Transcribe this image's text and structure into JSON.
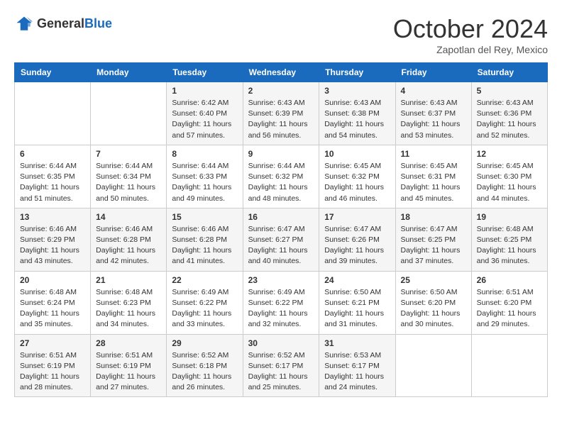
{
  "header": {
    "logo_general": "General",
    "logo_blue": "Blue",
    "month_title": "October 2024",
    "location": "Zapotlan del Rey, Mexico"
  },
  "days_of_week": [
    "Sunday",
    "Monday",
    "Tuesday",
    "Wednesday",
    "Thursday",
    "Friday",
    "Saturday"
  ],
  "weeks": [
    [
      {
        "day": "",
        "info": ""
      },
      {
        "day": "",
        "info": ""
      },
      {
        "day": "1",
        "info": "Sunrise: 6:42 AM\nSunset: 6:40 PM\nDaylight: 11 hours and 57 minutes."
      },
      {
        "day": "2",
        "info": "Sunrise: 6:43 AM\nSunset: 6:39 PM\nDaylight: 11 hours and 56 minutes."
      },
      {
        "day": "3",
        "info": "Sunrise: 6:43 AM\nSunset: 6:38 PM\nDaylight: 11 hours and 54 minutes."
      },
      {
        "day": "4",
        "info": "Sunrise: 6:43 AM\nSunset: 6:37 PM\nDaylight: 11 hours and 53 minutes."
      },
      {
        "day": "5",
        "info": "Sunrise: 6:43 AM\nSunset: 6:36 PM\nDaylight: 11 hours and 52 minutes."
      }
    ],
    [
      {
        "day": "6",
        "info": "Sunrise: 6:44 AM\nSunset: 6:35 PM\nDaylight: 11 hours and 51 minutes."
      },
      {
        "day": "7",
        "info": "Sunrise: 6:44 AM\nSunset: 6:34 PM\nDaylight: 11 hours and 50 minutes."
      },
      {
        "day": "8",
        "info": "Sunrise: 6:44 AM\nSunset: 6:33 PM\nDaylight: 11 hours and 49 minutes."
      },
      {
        "day": "9",
        "info": "Sunrise: 6:44 AM\nSunset: 6:32 PM\nDaylight: 11 hours and 48 minutes."
      },
      {
        "day": "10",
        "info": "Sunrise: 6:45 AM\nSunset: 6:32 PM\nDaylight: 11 hours and 46 minutes."
      },
      {
        "day": "11",
        "info": "Sunrise: 6:45 AM\nSunset: 6:31 PM\nDaylight: 11 hours and 45 minutes."
      },
      {
        "day": "12",
        "info": "Sunrise: 6:45 AM\nSunset: 6:30 PM\nDaylight: 11 hours and 44 minutes."
      }
    ],
    [
      {
        "day": "13",
        "info": "Sunrise: 6:46 AM\nSunset: 6:29 PM\nDaylight: 11 hours and 43 minutes."
      },
      {
        "day": "14",
        "info": "Sunrise: 6:46 AM\nSunset: 6:28 PM\nDaylight: 11 hours and 42 minutes."
      },
      {
        "day": "15",
        "info": "Sunrise: 6:46 AM\nSunset: 6:28 PM\nDaylight: 11 hours and 41 minutes."
      },
      {
        "day": "16",
        "info": "Sunrise: 6:47 AM\nSunset: 6:27 PM\nDaylight: 11 hours and 40 minutes."
      },
      {
        "day": "17",
        "info": "Sunrise: 6:47 AM\nSunset: 6:26 PM\nDaylight: 11 hours and 39 minutes."
      },
      {
        "day": "18",
        "info": "Sunrise: 6:47 AM\nSunset: 6:25 PM\nDaylight: 11 hours and 37 minutes."
      },
      {
        "day": "19",
        "info": "Sunrise: 6:48 AM\nSunset: 6:25 PM\nDaylight: 11 hours and 36 minutes."
      }
    ],
    [
      {
        "day": "20",
        "info": "Sunrise: 6:48 AM\nSunset: 6:24 PM\nDaylight: 11 hours and 35 minutes."
      },
      {
        "day": "21",
        "info": "Sunrise: 6:48 AM\nSunset: 6:23 PM\nDaylight: 11 hours and 34 minutes."
      },
      {
        "day": "22",
        "info": "Sunrise: 6:49 AM\nSunset: 6:22 PM\nDaylight: 11 hours and 33 minutes."
      },
      {
        "day": "23",
        "info": "Sunrise: 6:49 AM\nSunset: 6:22 PM\nDaylight: 11 hours and 32 minutes."
      },
      {
        "day": "24",
        "info": "Sunrise: 6:50 AM\nSunset: 6:21 PM\nDaylight: 11 hours and 31 minutes."
      },
      {
        "day": "25",
        "info": "Sunrise: 6:50 AM\nSunset: 6:20 PM\nDaylight: 11 hours and 30 minutes."
      },
      {
        "day": "26",
        "info": "Sunrise: 6:51 AM\nSunset: 6:20 PM\nDaylight: 11 hours and 29 minutes."
      }
    ],
    [
      {
        "day": "27",
        "info": "Sunrise: 6:51 AM\nSunset: 6:19 PM\nDaylight: 11 hours and 28 minutes."
      },
      {
        "day": "28",
        "info": "Sunrise: 6:51 AM\nSunset: 6:19 PM\nDaylight: 11 hours and 27 minutes."
      },
      {
        "day": "29",
        "info": "Sunrise: 6:52 AM\nSunset: 6:18 PM\nDaylight: 11 hours and 26 minutes."
      },
      {
        "day": "30",
        "info": "Sunrise: 6:52 AM\nSunset: 6:17 PM\nDaylight: 11 hours and 25 minutes."
      },
      {
        "day": "31",
        "info": "Sunrise: 6:53 AM\nSunset: 6:17 PM\nDaylight: 11 hours and 24 minutes."
      },
      {
        "day": "",
        "info": ""
      },
      {
        "day": "",
        "info": ""
      }
    ]
  ]
}
